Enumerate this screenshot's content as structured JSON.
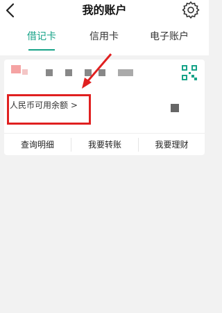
{
  "header": {
    "title": "我的账户",
    "back_icon": "chevron-left-icon",
    "settings_icon": "gear-icon"
  },
  "tabs": [
    {
      "label": "借记卡",
      "active": true
    },
    {
      "label": "信用卡",
      "active": false
    },
    {
      "label": "电子账户",
      "active": false
    }
  ],
  "card": {
    "balance_label": "人民币可用余额 >",
    "qr_icon": "qr-code-icon",
    "actions": [
      "查询明细",
      "我要转账",
      "我要理财"
    ]
  },
  "colors": {
    "accent": "#17a388",
    "highlight": "#e02020",
    "background": "#f2f2f2"
  }
}
